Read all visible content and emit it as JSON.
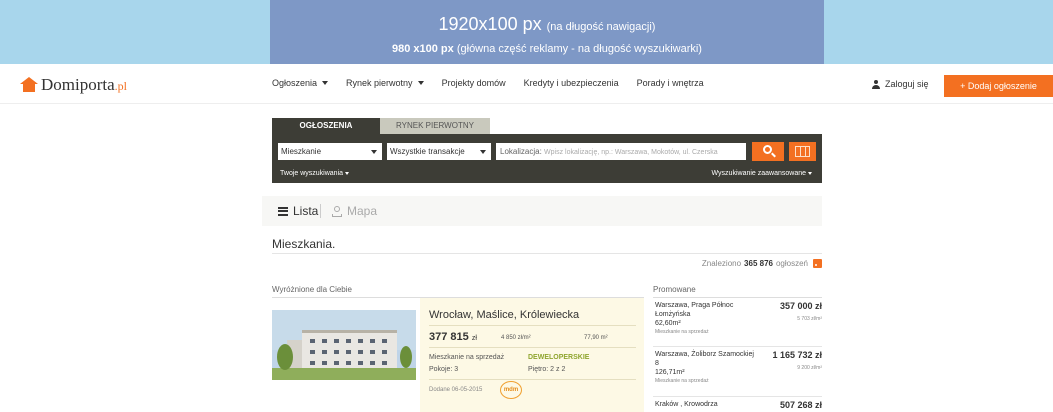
{
  "ad": {
    "title_big": "1920x100 px",
    "title_small": "(na długość nawigacji)",
    "sub_bold": "980 x100 px",
    "sub_rest": "(główna część reklamy - na długość wyszukiwarki)"
  },
  "nav": {
    "logo_main": "Domiporta",
    "logo_tld": ".pl",
    "items": [
      "Ogłoszenia",
      "Rynek pierwotny",
      "Projekty domów",
      "Kredyty i ubezpieczenia",
      "Porady i wnętrza"
    ],
    "login": "Zaloguj się",
    "add_button": "+ Dodaj ogłoszenie"
  },
  "search": {
    "tab_active": "OGŁOSZENIA",
    "tab_inactive": "RYNEK PIERWOTNY",
    "property_type": "Mieszkanie",
    "transaction_type": "Wszystkie transakcje",
    "location_label": "Lokalizacja:",
    "location_placeholder": "Wpisz lokalizację, np.: Warszawa, Mokotów, ul. Czerska",
    "your_searches": "Twoje wyszukiwania",
    "advanced_search": "Wyszukiwanie zaawansowane"
  },
  "view": {
    "list": "Lista",
    "map": "Mapa"
  },
  "results": {
    "title": "Mieszkania.",
    "found_prefix": "Znaleziono",
    "found_count": "365 876",
    "found_suffix": "ogłoszeń"
  },
  "featured": {
    "heading": "Wyróżnione dla Ciebie",
    "title": "Wrocław, Maślice, Królewiecka",
    "price": "377 815",
    "currency": "zł",
    "price_per_m2": "4 850 zł/m²",
    "area": "77,90 m²",
    "type": "Mieszkanie na sprzedaż",
    "developer": "DEWELOPERSKIE",
    "rooms": "Pokoje: 3",
    "floor": "Piętro: 2 z 2",
    "date": "Dodane 06-05-2015",
    "badge": "mdm"
  },
  "promoted": {
    "heading": "Promowane",
    "items": [
      {
        "location": "Warszawa, Praga Północ Łomżyńska",
        "area": "62,60m²",
        "type": "Mieszkanie na sprzedaż",
        "price": "357 000 zł",
        "ppm": "5 703 zł/m²"
      },
      {
        "location": "Warszawa, Żoliborz Szamockiej 8",
        "area": "126,71m²",
        "type": "Mieszkanie na sprzedaż",
        "price": "1 165 732 zł",
        "ppm": "9 200 zł/m²"
      },
      {
        "location": "Kraków , Krowodrza",
        "area": "",
        "type": "",
        "price": "507 268 zł",
        "ppm": ""
      }
    ]
  }
}
